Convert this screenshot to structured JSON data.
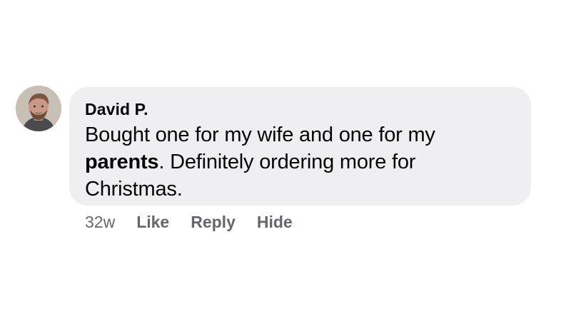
{
  "comment": {
    "author": "David P.",
    "text_before": "Bought one for my wife and one for my ",
    "text_bold": "parents",
    "text_after": ". Definitely ordering more for Christmas.",
    "timestamp": "32w",
    "actions": {
      "like": "Like",
      "reply": "Reply",
      "hide": "Hide"
    }
  },
  "colors": {
    "bubble_background": "#efeff1",
    "primary_text": "#050505",
    "secondary_text": "#65676b"
  },
  "icons": {
    "avatar": "profile-photo"
  }
}
